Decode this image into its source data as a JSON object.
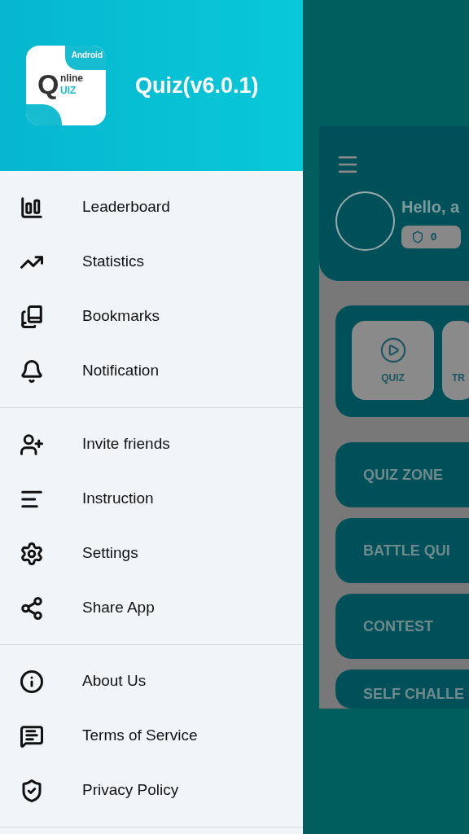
{
  "drawer": {
    "logo": {
      "badge": "Android",
      "letter": "Q",
      "word_top": "nline",
      "word_bottom": "UIZ"
    },
    "title": "Quiz(v6.0.1)",
    "sections": [
      {
        "items": [
          {
            "label": "Leaderboard"
          },
          {
            "label": "Statistics"
          },
          {
            "label": "Bookmarks"
          },
          {
            "label": "Notification"
          }
        ]
      },
      {
        "items": [
          {
            "label": "Invite friends"
          },
          {
            "label": "Instruction"
          },
          {
            "label": "Settings"
          },
          {
            "label": "Share App"
          }
        ]
      },
      {
        "items": [
          {
            "label": "About Us"
          },
          {
            "label": "Terms of Service"
          },
          {
            "label": "Privacy Policy"
          }
        ]
      }
    ]
  },
  "background_screen": {
    "greeting": "Hello, a",
    "badge_count": "0",
    "tiles": [
      {
        "label": "QUIZ"
      },
      {
        "label": "TR"
      }
    ],
    "buttons": [
      {
        "label": "QUIZ ZONE"
      },
      {
        "label": "BATTLE QUI"
      },
      {
        "label": "CONTEST"
      },
      {
        "label": "SELF CHALLE"
      }
    ]
  }
}
